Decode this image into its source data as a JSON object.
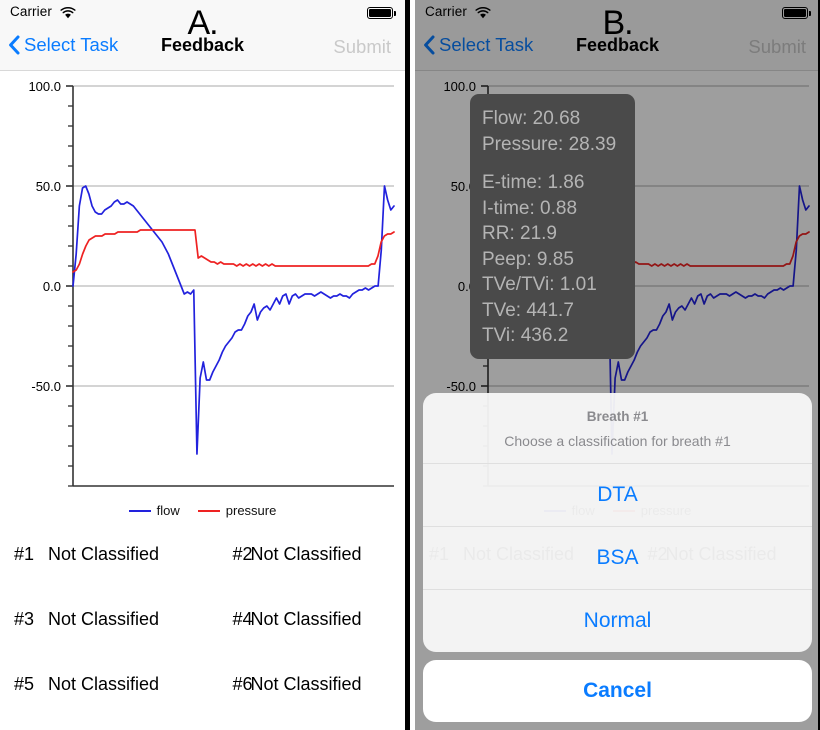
{
  "statusbar": {
    "carrier": "Carrier",
    "wifi_icon": "wifi-icon",
    "battery_icon": "battery-full-icon"
  },
  "panel_a": {
    "letter": "A.",
    "nav": {
      "back_label": "Select Task",
      "title": "Feedback",
      "submit_label": "Submit",
      "back_icon": "chevron-left-icon"
    }
  },
  "panel_b": {
    "letter": "B.",
    "nav": {
      "back_label": "Select Task",
      "title": "Feedback",
      "submit_label": "Submit",
      "back_icon": "chevron-left-icon"
    }
  },
  "tooltip": {
    "flow": "Flow: 20.68",
    "pressure": "Pressure: 28.39",
    "etime": "E-time: 1.86",
    "itime": "I-time: 0.88",
    "rr": "RR: 21.9",
    "peep": "Peep: 9.85",
    "tve_tvi_ratio": "TVe/TVi: 1.01",
    "tve": "TVe: 441.7",
    "tvi": "TVi: 436.2"
  },
  "action_sheet": {
    "title": "Breath #1",
    "message": "Choose a classification for breath #1",
    "options": [
      {
        "label": "DTA"
      },
      {
        "label": "BSA"
      },
      {
        "label": "Normal"
      }
    ],
    "cancel_label": "Cancel"
  },
  "breaths": [
    {
      "num": "#1",
      "status": "Not Classified"
    },
    {
      "num": "#2",
      "status": "Not Classified"
    },
    {
      "num": "#3",
      "status": "Not Classified"
    },
    {
      "num": "#4",
      "status": "Not Classified"
    },
    {
      "num": "#5",
      "status": "Not Classified"
    },
    {
      "num": "#6",
      "status": "Not Classified"
    }
  ],
  "colors": {
    "flow": "#2222dd",
    "pressure": "#ee2222",
    "accent": "#0a7cff",
    "grid": "#aaaaaa",
    "axis": "#333333",
    "disabled": "#c9c9c9"
  },
  "chart_data": {
    "type": "line",
    "title": "",
    "xlabel": "",
    "ylabel": "",
    "ylim": [
      -100,
      100
    ],
    "yticks": [
      100.0,
      50.0,
      0.0,
      -50.0
    ],
    "ytick_labels": [
      "100.0",
      "50.0",
      "0.0",
      "-50.0"
    ],
    "grid": true,
    "legend": {
      "position": "bottom",
      "entries": [
        "flow",
        "pressure"
      ]
    },
    "series": [
      {
        "name": "flow",
        "color": "#2222dd",
        "x": [
          0,
          1,
          2,
          3,
          4,
          5,
          6,
          7,
          8,
          9,
          10,
          11,
          12,
          13,
          14,
          15,
          16,
          17,
          18,
          19,
          20,
          21,
          22,
          23,
          24,
          25,
          26,
          27,
          28,
          29,
          30,
          31,
          32,
          33,
          34,
          35,
          36,
          37,
          38,
          39,
          40,
          41,
          42,
          43,
          44,
          45,
          46,
          47,
          48,
          49,
          50,
          51,
          52,
          53,
          54,
          55,
          56,
          57,
          58,
          59,
          60,
          61,
          62,
          63,
          64,
          65,
          66,
          67,
          68,
          69,
          70,
          71,
          72,
          73,
          74,
          75,
          76,
          77,
          78,
          79,
          80,
          81,
          82,
          83,
          84,
          85,
          86,
          87,
          88,
          89,
          90,
          91,
          92,
          93,
          94,
          95,
          96,
          97,
          98,
          99,
          100
        ],
        "values": [
          0,
          16,
          40,
          49,
          50,
          46,
          40,
          37,
          36,
          36,
          38,
          39,
          40,
          42,
          43,
          41,
          41,
          42,
          41,
          40,
          38,
          36,
          34,
          32,
          30,
          28,
          26,
          24,
          22,
          19,
          16,
          12,
          8,
          4,
          0,
          -4,
          -3,
          -4,
          -2,
          -84,
          -46,
          -38,
          -47,
          -47,
          -43,
          -40,
          -37,
          -33,
          -30,
          -28,
          -26,
          -23,
          -22,
          -22,
          -19,
          -15,
          -13,
          -9,
          -17,
          -13,
          -11,
          -10,
          -12,
          -9,
          -6,
          -9,
          -5,
          -4,
          -9,
          -5,
          -4,
          -6,
          -5,
          -4,
          -4,
          -4,
          -5,
          -4,
          -3,
          -4,
          -5,
          -6,
          -5,
          -5,
          -4,
          -5,
          -5,
          -6,
          -4,
          -3,
          -2,
          -2,
          -1,
          -2,
          -1,
          0,
          0,
          18,
          50,
          43,
          38,
          40
        ]
      },
      {
        "name": "pressure",
        "color": "#ee2222",
        "x": [
          0,
          1,
          2,
          3,
          4,
          5,
          6,
          7,
          8,
          9,
          10,
          11,
          12,
          13,
          14,
          15,
          16,
          17,
          18,
          19,
          20,
          21,
          22,
          23,
          24,
          25,
          26,
          27,
          28,
          29,
          30,
          31,
          32,
          33,
          34,
          35,
          36,
          37,
          38,
          39,
          40,
          41,
          42,
          43,
          44,
          45,
          46,
          47,
          48,
          49,
          50,
          51,
          52,
          53,
          54,
          55,
          56,
          57,
          58,
          59,
          60,
          61,
          62,
          63,
          64,
          65,
          66,
          67,
          68,
          69,
          70,
          71,
          72,
          73,
          74,
          75,
          76,
          77,
          78,
          79,
          80,
          81,
          82,
          83,
          84,
          85,
          86,
          87,
          88,
          89,
          90,
          91,
          92,
          93,
          94,
          95,
          96,
          97,
          98,
          99,
          100
        ],
        "values": [
          7,
          8,
          11,
          16,
          20,
          23,
          24,
          25,
          25,
          25,
          26,
          26,
          26,
          26,
          27,
          27,
          27,
          27,
          27,
          27,
          27,
          28,
          28,
          28,
          28,
          28,
          28,
          28,
          28,
          28,
          28,
          28,
          28,
          28,
          28,
          28,
          28,
          28,
          28,
          14,
          15,
          14,
          13,
          12,
          12,
          11,
          12,
          11,
          11,
          11,
          11,
          10,
          11,
          10,
          11,
          10,
          11,
          10,
          11,
          10,
          11,
          10,
          11,
          10,
          10,
          10,
          10,
          10,
          10,
          10,
          10,
          10,
          10,
          10,
          10,
          10,
          10,
          10,
          10,
          10,
          10,
          10,
          10,
          10,
          10,
          10,
          10,
          10,
          10,
          10,
          10,
          10,
          10,
          11,
          11,
          15,
          22,
          25,
          26,
          26,
          27
        ]
      }
    ]
  }
}
